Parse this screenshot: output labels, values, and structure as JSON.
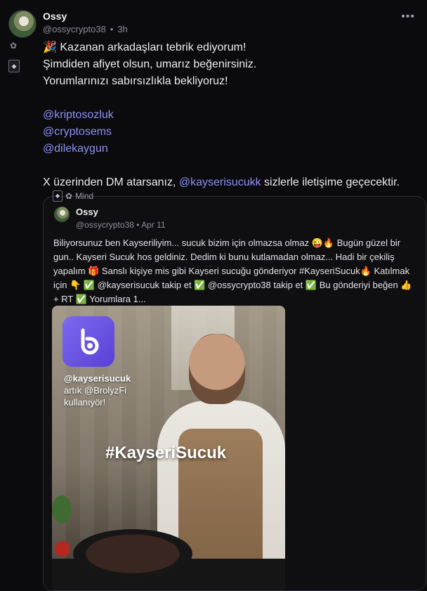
{
  "post": {
    "author": "Ossy",
    "handle": "@ossycrypto38",
    "separator": "•",
    "time": "3h",
    "more": "•••",
    "lines": [
      "🎉 Kazanan arkadaşları tebrik ediyorum!",
      "Şimdiden afiyet olsun, umarız beğenirsiniz.",
      "Yorumlarınızı sabırsızlıkla bekliyoruz!"
    ],
    "mentions": [
      "@kriptosozluk",
      "@cryptosems",
      "@dilekaygun"
    ],
    "dm_prefix": "X üzerinden DM atarsanız, ",
    "dm_mention": "@kayserisucukk",
    "dm_suffix": " sizlerle iletişime geçecektir."
  },
  "quote": {
    "label": "Mind",
    "author": "Ossy",
    "handle": "@ossycrypto38",
    "separator": "•",
    "date": "Apr 11",
    "text": "Biliyorsunuz ben Kayseriliyim... sucuk bizim için olmazsa olmaz 😜🔥 Bugün güzel bir gun.. Kayseri Sucuk hos geldiniz. Dedim ki bunu kutlamadan olmaz... Hadi bir çekiliş yapalım 🎁 Sanslı kişiye mis gibi Kayseri sucuğu gönderiyor #KayseriSucuk🔥 Katılmak için 👇 ✅ @kayserisucuk takip et ✅ @ossycrypto38 takip et ✅ Bu gönderiyi beğen 👍 + RT ✅ Yorumlara 1..."
  },
  "media": {
    "overlay_line1": "@kayserisucuk",
    "overlay_line2": "artık @BrolyzFi",
    "overlay_line3": "kullanıyör!",
    "hashtag": "#KayseriSucuk"
  },
  "icons": {
    "side_mind": "mind-icon",
    "side_badge": "profile-badge-icon",
    "logo": "b-logo-icon"
  },
  "colors": {
    "background": "#0b0b0d",
    "mention": "#8f8ff5",
    "logo": "#6a55e6"
  }
}
